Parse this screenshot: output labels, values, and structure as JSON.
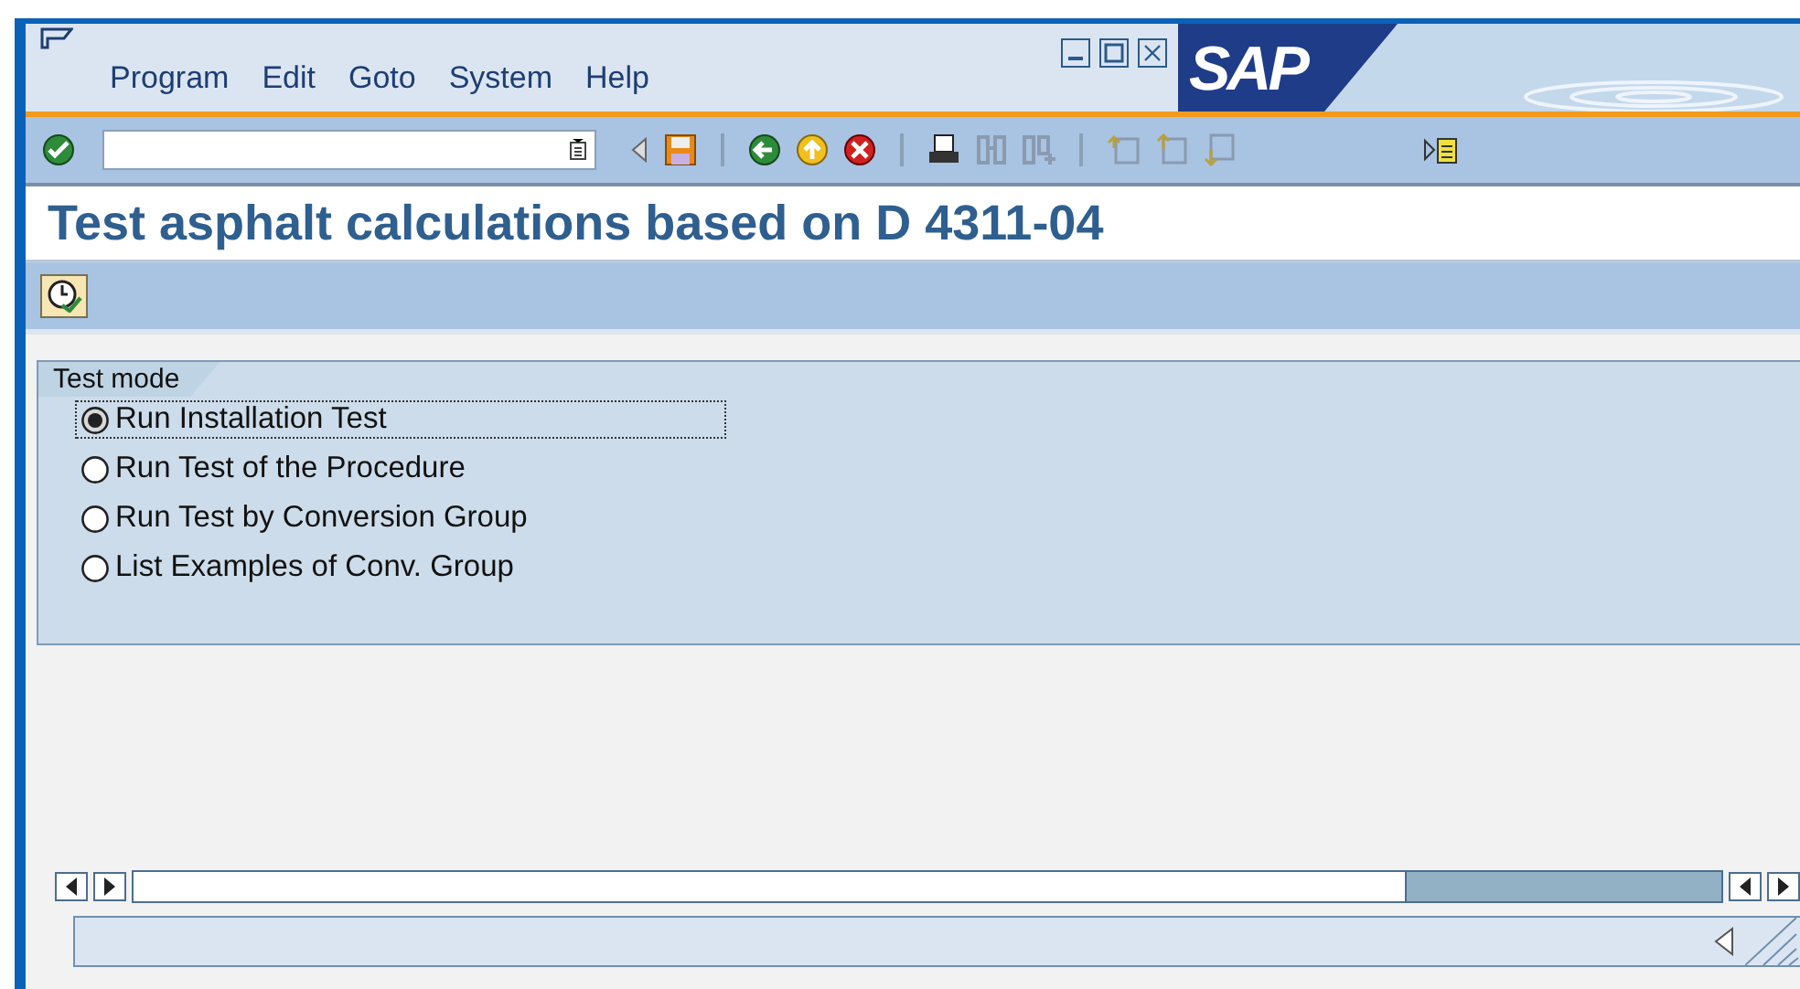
{
  "menu": [
    {
      "label": "Program"
    },
    {
      "label": "Edit"
    },
    {
      "label": "Goto"
    },
    {
      "label": "System"
    },
    {
      "label": "Help"
    }
  ],
  "logo": "SAP",
  "title": "Test asphalt calculations based on D 4311-04",
  "group": {
    "title": "Test mode",
    "options": [
      {
        "label": "Run Installation Test",
        "selected": true,
        "focused": true
      },
      {
        "label": "Run Test of the Procedure",
        "selected": false,
        "focused": false
      },
      {
        "label": "Run Test by Conversion Group",
        "selected": false,
        "focused": false
      },
      {
        "label": "List Examples of Conv. Group",
        "selected": false,
        "focused": false
      }
    ]
  }
}
